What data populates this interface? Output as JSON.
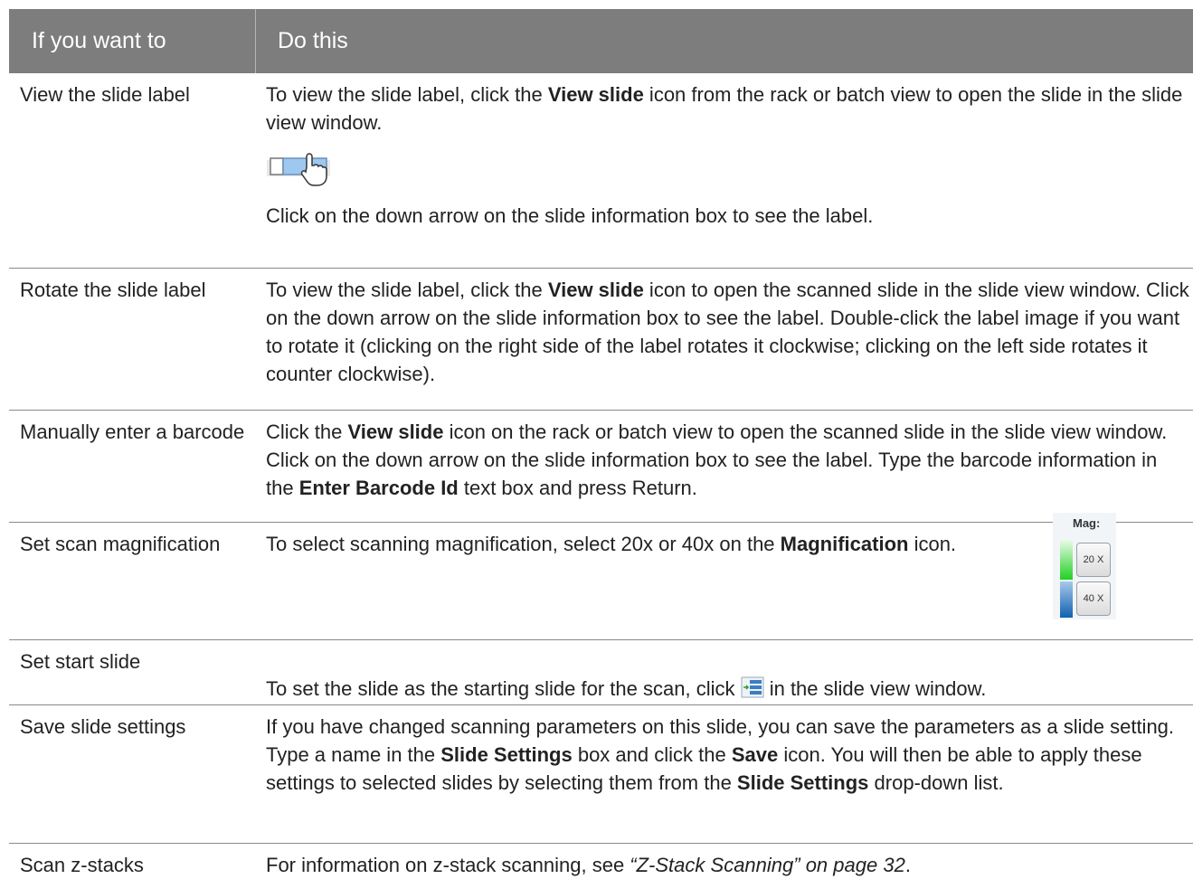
{
  "header": {
    "col1": "If you want to",
    "col2": "Do this"
  },
  "rows": [
    {
      "action": "View the slide label",
      "p1_a": "To view the slide label, click the ",
      "p1_b": "View slide",
      "p1_c": " icon from the rack or batch view to open the slide in the slide view window.",
      "p2": "Click on the down arrow on the slide information box to see the label."
    },
    {
      "action": "Rotate the slide label",
      "a": "To view the slide label, click the ",
      "b": "View slide",
      "c": " icon to open the scanned slide in the slide view window. Click on the down arrow on the slide information box to see the label. Double-click the label image if you want to rotate it (clicking on the right side of the label rotates it clockwise; clicking on the left side rotates it counter clockwise)."
    },
    {
      "action": "Manually enter a barcode",
      "a": "Click the ",
      "b": "View slide",
      "c": " icon on the rack or batch view to open the scanned slide in the slide view window. Click on the down arrow on the slide information box to see the label. Type the barcode information in the ",
      "d": "Enter Barcode Id",
      "e": " text box and press Return."
    },
    {
      "action": "Set scan magnification",
      "a": "To select scanning magnification, select 20x or 40x on the ",
      "b": "Magnification",
      "c": " icon.",
      "mag_title": "Mag:",
      "btn1": "20 X",
      "btn2": "40 X"
    },
    {
      "action": "Set start slide",
      "a": "To set the slide as the starting slide for the scan, click ",
      "c": " in the slide view window."
    },
    {
      "action": "Save slide settings",
      "a": "If you have changed scanning parameters on this slide, you can save the parameters as a slide setting. Type a name in the ",
      "b": "Slide Settings",
      "c": " box and click the ",
      "d": "Save",
      "e": " icon. You will then be able to apply these settings to selected slides by selecting them from the ",
      "f": "Slide Settings",
      "g": " drop-down list."
    },
    {
      "action": "Scan z-stacks",
      "a": "For information on z-stack scanning, see ",
      "b": "“Z-Stack Scanning” on page 32",
      "c": "."
    }
  ],
  "icons": {
    "view_slide": "view-slide-icon",
    "start_slide": "start-slide-icon",
    "pointer": "hand-pointer-icon"
  }
}
